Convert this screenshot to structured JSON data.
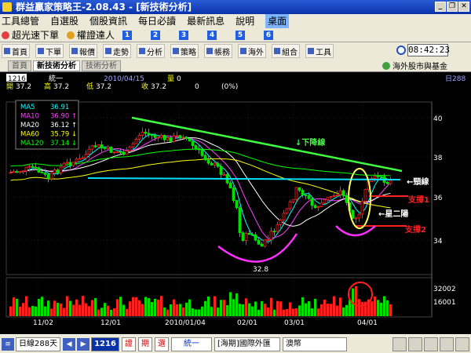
{
  "window": {
    "title": "群益贏家策略王-2.08.43 - [新技術分析]"
  },
  "menu": {
    "items": [
      "工具總管",
      "自選股",
      "個股資訊",
      "每日必讀",
      "最新訊息",
      "說明",
      "桌面"
    ]
  },
  "quickbar": {
    "items": [
      "超光速下單",
      "權證達人"
    ],
    "numbers": [
      "1",
      "2",
      "3",
      "4",
      "5",
      "6"
    ]
  },
  "toolbar": {
    "items": [
      "首頁",
      "下單",
      "報價",
      "走勢",
      "分析",
      "策略",
      "帳務",
      "海外",
      "組合",
      "工具"
    ],
    "clock": "08:42:23"
  },
  "tabs": {
    "items": [
      "首頁",
      "新技術分析",
      "技術分析"
    ],
    "active": "新技術分析",
    "overseas": "海外股市與基金"
  },
  "chart": {
    "code": "1216",
    "name": "統一",
    "date": "2010/04/15",
    "volume_label": "量",
    "volume_value": "0",
    "period_label": "日288",
    "open_label": "開",
    "open": "37.2",
    "high_label": "高",
    "high": "37.2",
    "low_label": "低",
    "low": "37.2",
    "close_label": "收",
    "close": "37.2",
    "change": "0",
    "change_pct": "(0%)",
    "ma": [
      {
        "name": "MA5",
        "value": "36.91",
        "color": "#00ffff",
        "arrow": ""
      },
      {
        "name": "MA10",
        "value": "36.90",
        "color": "#ff40ff",
        "arrow": "↑"
      },
      {
        "name": "MA20",
        "value": "36.12",
        "color": "#ffffff",
        "arrow": "↑"
      },
      {
        "name": "MA60",
        "value": "35.79",
        "color": "#ffff00",
        "arrow": "↓"
      },
      {
        "name": "MA120",
        "value": "37.14",
        "color": "#00ff00",
        "arrow": "↓"
      }
    ],
    "price_ticks": [
      "40",
      "38",
      "36",
      "34"
    ],
    "volume_ticks": [
      "32002",
      "16001"
    ],
    "x_ticks": [
      "11/02",
      "12/01",
      "2010/01/04",
      "02/01",
      "03/01",
      "04/01"
    ],
    "low_point_label": "32.8",
    "annotations": {
      "downtrend": "↓下降線",
      "neckline": "←頸線",
      "support1": "支撐1",
      "support2": "支撐2",
      "star": "←星二陽"
    },
    "colors": {
      "up": "#ff2020",
      "down": "#00e000",
      "neckline": "#00e0ff",
      "trend": "#40ff40",
      "support": "#ff2020"
    }
  },
  "status": {
    "period": "日線288天",
    "code": "1216",
    "tag1": "證",
    "tag2": "期",
    "tag3": "選",
    "name": "統一",
    "market": "[海期]國際外匯",
    "currency": "澳幣"
  }
}
